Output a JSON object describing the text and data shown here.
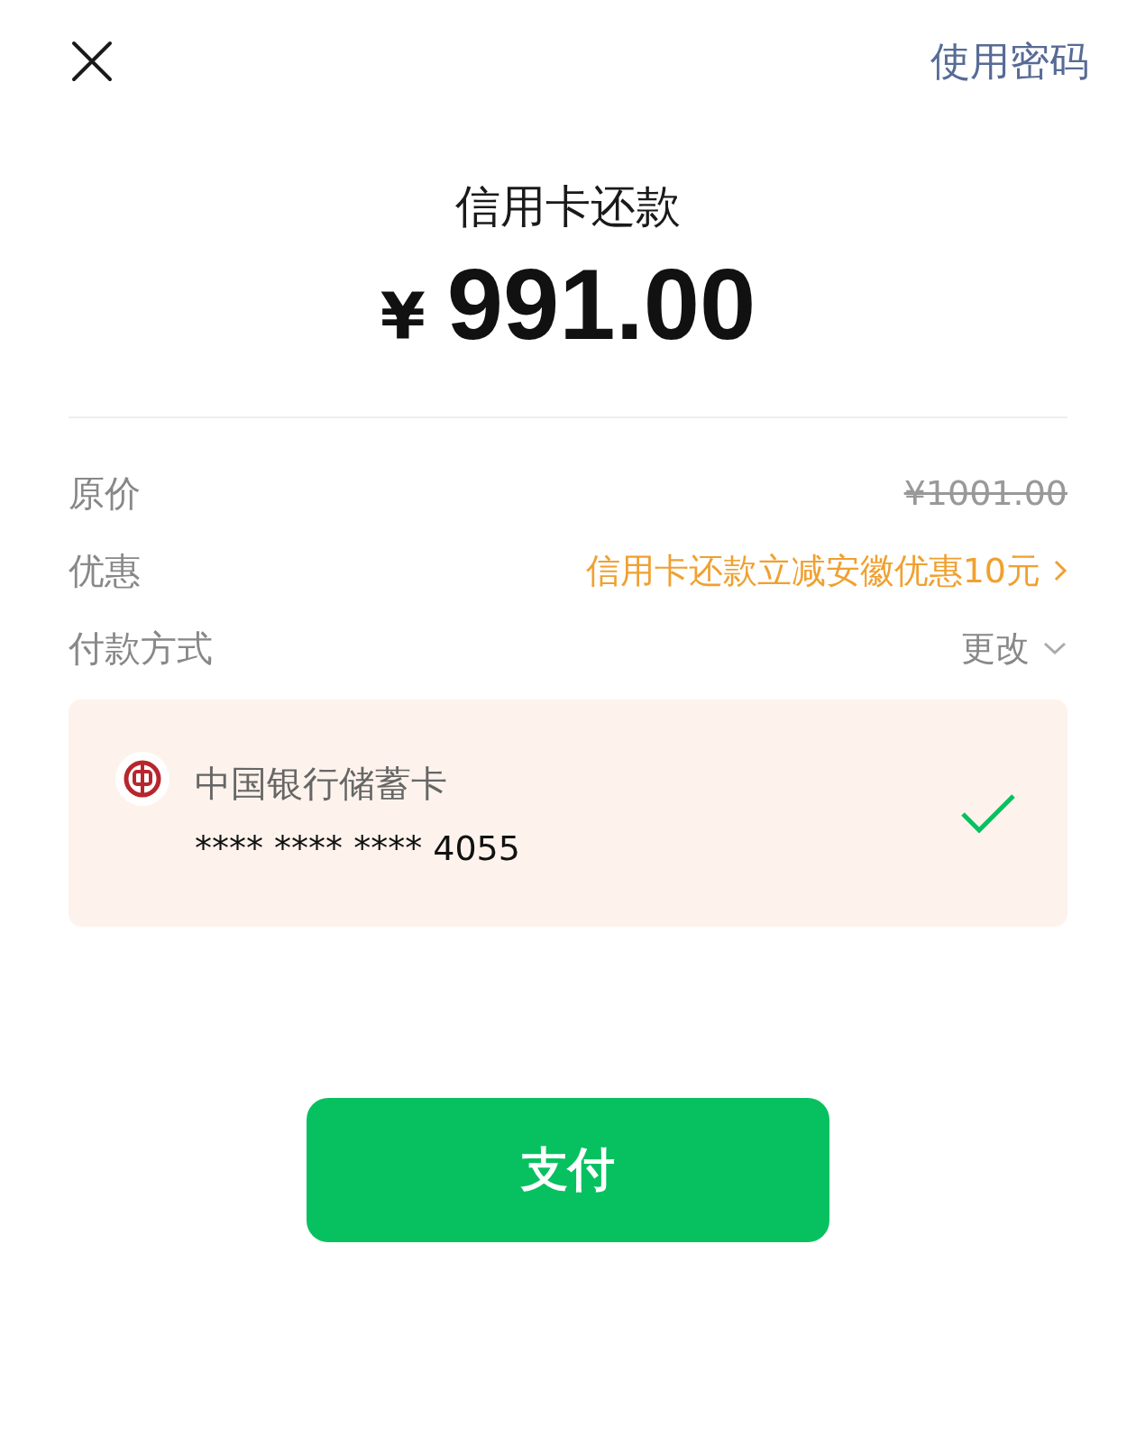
{
  "header": {
    "action": "使用密码"
  },
  "title": "信用卡还款",
  "amount": {
    "currency": "¥",
    "value": "991.00"
  },
  "rows": [
    {
      "kind": "price",
      "label": "原价",
      "value": "¥1001.00"
    },
    {
      "kind": "discount",
      "label": "优惠",
      "value": "信用卡还款立减安徽优惠10元"
    },
    {
      "kind": "method",
      "label": "付款方式",
      "value": "更改"
    }
  ],
  "card": {
    "name": "中国银行储蓄卡",
    "number": "**** **** **** 4055",
    "selected": true
  },
  "pay_button": "支付"
}
